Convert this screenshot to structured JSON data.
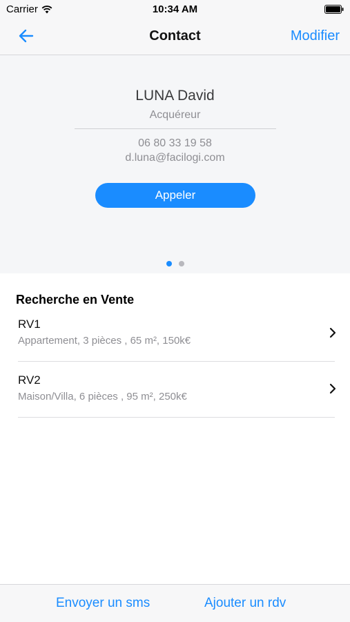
{
  "status_bar": {
    "carrier": "Carrier",
    "time": "10:34 AM",
    "wifi_icon": "wifi-icon",
    "battery_icon": "battery-full-icon"
  },
  "nav": {
    "back_icon": "arrow-left-icon",
    "title": "Contact",
    "edit_label": "Modifier"
  },
  "contact": {
    "name": "LUNA David",
    "role": "Acquéreur",
    "phone": "06 80 33 19 58",
    "email": "d.luna@facilogi.com",
    "call_label": "Appeler",
    "page_count": 2,
    "current_page": 1
  },
  "search": {
    "section_title": "Recherche en Vente",
    "items": [
      {
        "title": "RV1",
        "subtitle": "Appartement, 3 pièces , 65 m², 150k€"
      },
      {
        "title": "RV2",
        "subtitle": "Maison/Villa, 6 pièces , 95 m², 250k€"
      }
    ]
  },
  "bottom_bar": {
    "sms_label": "Envoyer un sms",
    "rdv_label": "Ajouter un rdv"
  },
  "colors": {
    "accent": "#1a8cff",
    "card_background": "#f5f6f8",
    "secondary_text": "#8e8e93"
  }
}
